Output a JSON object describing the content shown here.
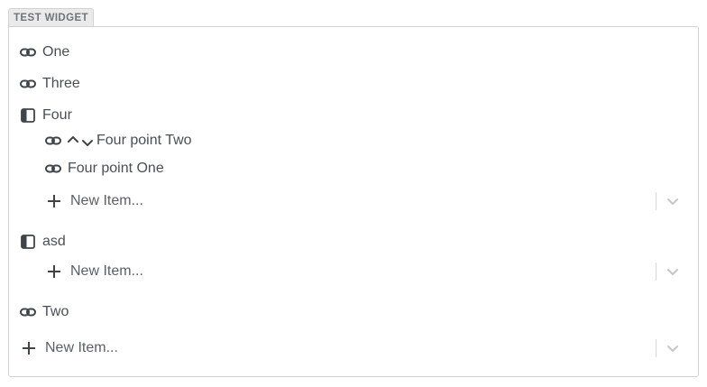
{
  "widget": {
    "title": "TEST WIDGET"
  },
  "items": [
    {
      "label": "One",
      "icon": "link-icon"
    },
    {
      "label": "Three",
      "icon": "link-icon"
    },
    {
      "label": "Four",
      "icon": "sidebar-panel-icon",
      "children": [
        {
          "label": "Four point Two",
          "icon": "link-icon",
          "has_move_controls": true
        },
        {
          "label": "Four point One",
          "icon": "link-icon"
        }
      ],
      "new_item_placeholder": "New Item..."
    },
    {
      "label": "asd",
      "icon": "sidebar-panel-icon",
      "new_item_placeholder": "New Item..."
    },
    {
      "label": "Two",
      "icon": "link-icon"
    }
  ],
  "root_new_item_placeholder": "New Item...",
  "colors": {
    "icon": "#3f444b",
    "text": "#4a4f57",
    "border": "#d2d2d2",
    "muted_chevron": "#c3c6ca"
  }
}
